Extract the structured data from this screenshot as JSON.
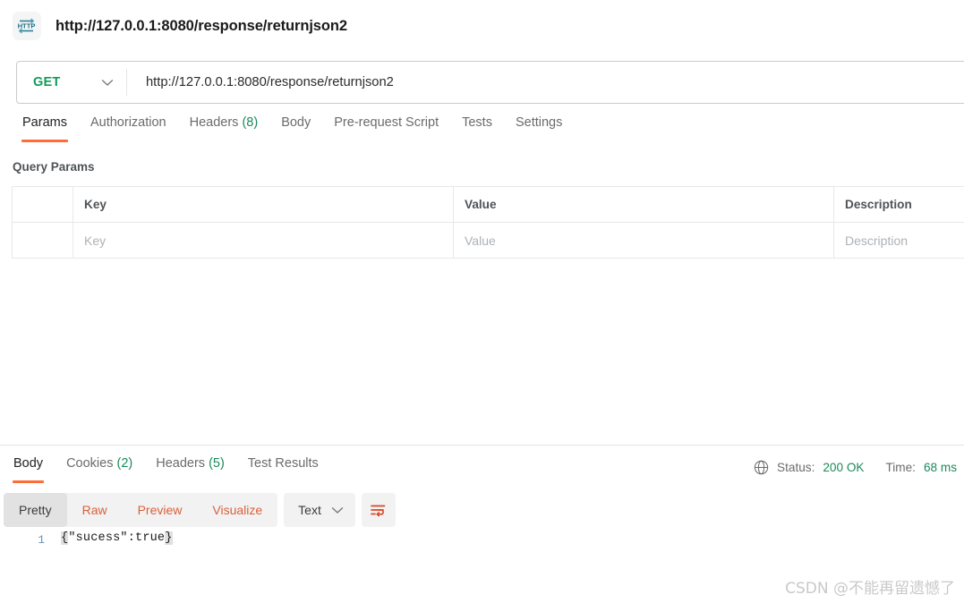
{
  "titlebar": {
    "icon": "http-protocol-icon",
    "title": "http://127.0.0.1:8080/response/returnjson2"
  },
  "request": {
    "method": "GET",
    "method_chevron": "chevron-down-icon",
    "url": "http://127.0.0.1:8080/response/returnjson2",
    "tabs": [
      {
        "label": "Params",
        "count": "",
        "active": true
      },
      {
        "label": "Authorization",
        "count": "",
        "active": false
      },
      {
        "label": "Headers",
        "count": "(8)",
        "active": false
      },
      {
        "label": "Body",
        "count": "",
        "active": false
      },
      {
        "label": "Pre-request Script",
        "count": "",
        "active": false
      },
      {
        "label": "Tests",
        "count": "",
        "active": false
      },
      {
        "label": "Settings",
        "count": "",
        "active": false
      }
    ],
    "query_params": {
      "section_title": "Query Params",
      "headers": [
        "",
        "Key",
        "Value",
        "Description"
      ],
      "rows": [
        {
          "key_placeholder": "Key",
          "value_placeholder": "Value",
          "description_placeholder": "Description"
        }
      ]
    }
  },
  "response": {
    "tabs": [
      {
        "label": "Body",
        "count": "",
        "active": true
      },
      {
        "label": "Cookies",
        "count": "(2)",
        "active": false
      },
      {
        "label": "Headers",
        "count": "(5)",
        "active": false
      },
      {
        "label": "Test Results",
        "count": "",
        "active": false
      }
    ],
    "meta": {
      "globe_icon": "globe-icon",
      "status_label": "Status:",
      "status_value": "200 OK",
      "time_label": "Time:",
      "time_value": "68 ms"
    },
    "view_modes": [
      {
        "label": "Pretty",
        "active": true
      },
      {
        "label": "Raw",
        "active": false
      },
      {
        "label": "Preview",
        "active": false
      },
      {
        "label": "Visualize",
        "active": false
      }
    ],
    "format": {
      "label": "Text",
      "chevron": "chevron-down-icon"
    },
    "wrap_button_icon": "wrap-lines-icon",
    "body": {
      "line_number": "1",
      "open_brace": "{",
      "content": "\"sucess\":true",
      "close_brace": "}"
    }
  },
  "watermark": "CSDN @不能再留遗憾了",
  "colors": {
    "accent": "#ff6c37",
    "success": "#1b8a5a",
    "method_get": "#0f9d58",
    "icon_teal": "#2a7f93"
  }
}
